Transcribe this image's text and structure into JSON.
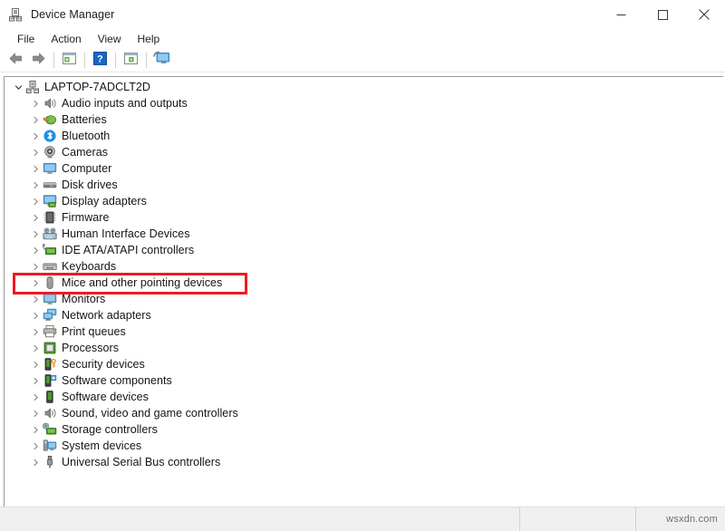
{
  "window": {
    "title": "Device Manager",
    "icon": "device-manager-icon",
    "controls": {
      "minimize": "—",
      "maximize": "□",
      "close": "×"
    }
  },
  "menubar": {
    "items": [
      {
        "label": "File"
      },
      {
        "label": "Action"
      },
      {
        "label": "View"
      },
      {
        "label": "Help"
      }
    ]
  },
  "toolbar": {
    "buttons": [
      {
        "name": "back-button",
        "icon": "arrow-left-icon"
      },
      {
        "name": "forward-button",
        "icon": "arrow-right-icon"
      },
      {
        "name": "properties-button",
        "icon": "properties-window-icon"
      },
      {
        "name": "help-button",
        "icon": "question-mark-icon"
      },
      {
        "name": "update-driver-button",
        "icon": "window-play-icon"
      },
      {
        "name": "scan-hardware-changes-button",
        "icon": "monitor-scan-icon"
      }
    ]
  },
  "tree": {
    "root": {
      "label": "LAPTOP-7ADCLT2D",
      "icon": "computer-node-icon",
      "expanded": true
    },
    "items": [
      {
        "label": "Audio inputs and outputs",
        "icon": "speaker-icon"
      },
      {
        "label": "Batteries",
        "icon": "battery-icon"
      },
      {
        "label": "Bluetooth",
        "icon": "bluetooth-icon"
      },
      {
        "label": "Cameras",
        "icon": "camera-icon"
      },
      {
        "label": "Computer",
        "icon": "monitor-icon"
      },
      {
        "label": "Disk drives",
        "icon": "disk-drive-icon"
      },
      {
        "label": "Display adapters",
        "icon": "display-adapter-icon"
      },
      {
        "label": "Firmware",
        "icon": "chip-icon"
      },
      {
        "label": "Human Interface Devices",
        "icon": "hid-icon"
      },
      {
        "label": "IDE ATA/ATAPI controllers",
        "icon": "ide-controller-icon"
      },
      {
        "label": "Keyboards",
        "icon": "keyboard-icon"
      },
      {
        "label": "Mice and other pointing devices",
        "icon": "mouse-icon",
        "highlighted": true
      },
      {
        "label": "Monitors",
        "icon": "monitor-icon"
      },
      {
        "label": "Network adapters",
        "icon": "network-adapter-icon"
      },
      {
        "label": "Print queues",
        "icon": "printer-icon"
      },
      {
        "label": "Processors",
        "icon": "processor-icon"
      },
      {
        "label": "Security devices",
        "icon": "security-device-icon"
      },
      {
        "label": "Software components",
        "icon": "software-component-icon"
      },
      {
        "label": "Software devices",
        "icon": "software-device-icon"
      },
      {
        "label": "Sound, video and game controllers",
        "icon": "speaker-icon"
      },
      {
        "label": "Storage controllers",
        "icon": "storage-controller-icon"
      },
      {
        "label": "System devices",
        "icon": "system-device-icon"
      },
      {
        "label": "Universal Serial Bus controllers",
        "icon": "usb-icon"
      }
    ]
  },
  "annotation": {
    "highlight_color": "#ED1B24",
    "highlight_target": "Mice and other pointing devices"
  },
  "statusbar": {
    "pane1": "",
    "pane2": "",
    "watermark": "wsxdn.com"
  }
}
